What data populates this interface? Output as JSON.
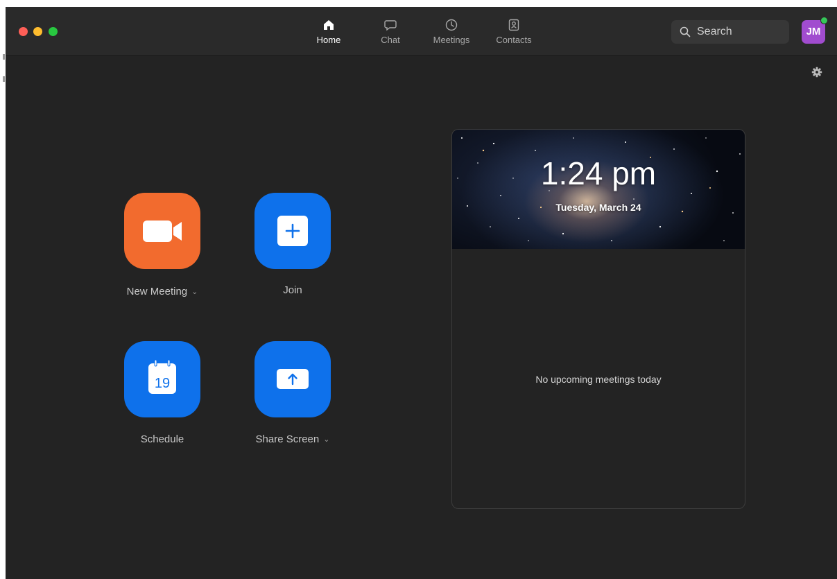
{
  "nav": {
    "tabs": [
      {
        "label": "Home",
        "icon": "home-icon",
        "active": true
      },
      {
        "label": "Chat",
        "icon": "chat-icon",
        "active": false
      },
      {
        "label": "Meetings",
        "icon": "clock-icon",
        "active": false
      },
      {
        "label": "Contacts",
        "icon": "contacts-icon",
        "active": false
      }
    ]
  },
  "search": {
    "label": "Search"
  },
  "user": {
    "initials": "JM",
    "status": "online"
  },
  "actions": {
    "new_meeting": "New Meeting",
    "join": "Join",
    "schedule": "Schedule",
    "schedule_day": "19",
    "share_screen": "Share Screen"
  },
  "calendar": {
    "time": "1:24 pm",
    "date": "Tuesday, March 24",
    "empty_message": "No upcoming meetings today"
  },
  "colors": {
    "background": "#232323",
    "titlebar": "#2a2a2a",
    "accent_blue": "#0e71eb",
    "accent_orange": "#f26b2e",
    "avatar": "#a14ccf",
    "online": "#35c759"
  }
}
